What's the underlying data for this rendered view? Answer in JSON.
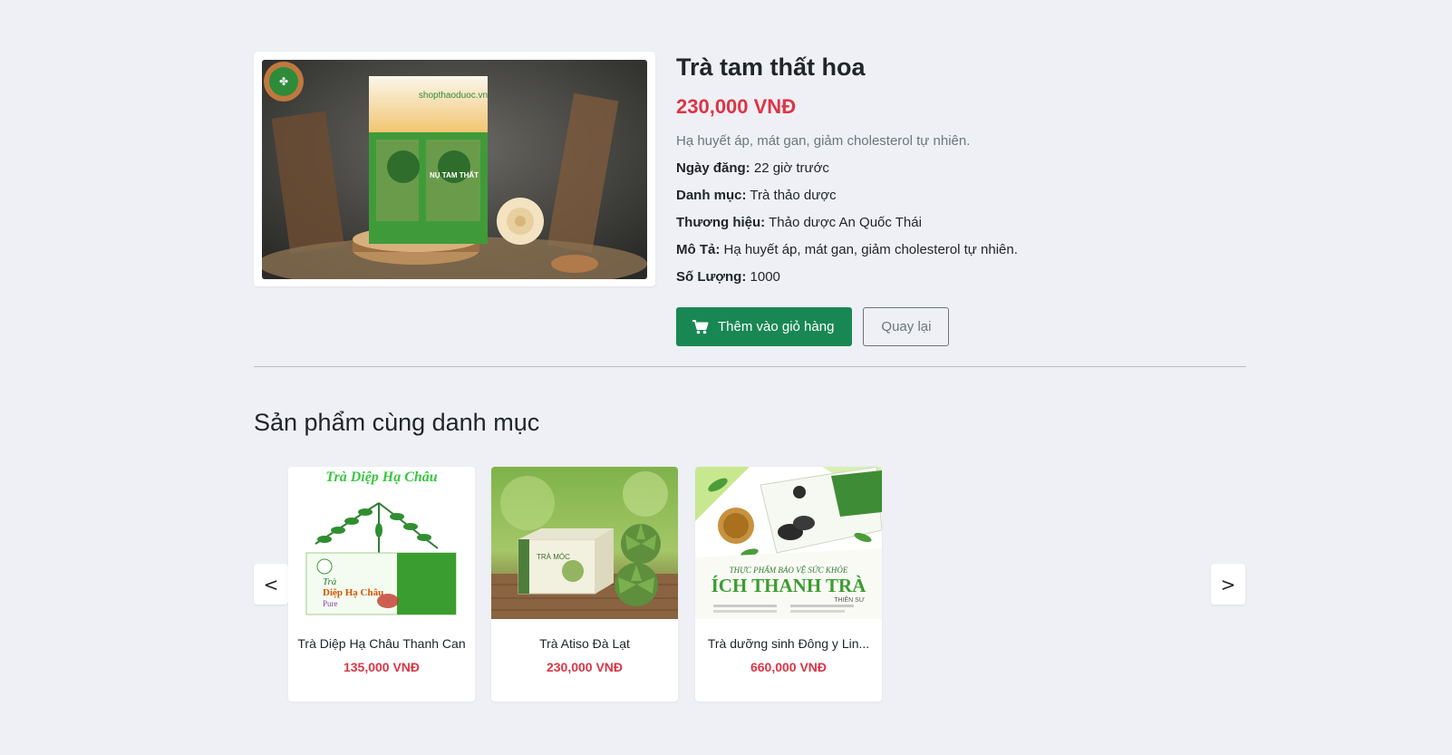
{
  "product": {
    "title": "Trà tam thất hoa",
    "price": "230,000 VNĐ",
    "short_desc": "Hạ huyết áp, mát gan, giảm cholesterol tự nhiên.",
    "image_brand_text": "shopthaoduoc.vn",
    "image_pack_text": "NỤ TAM THẤT",
    "meta": {
      "date_label": "Ngày đăng:",
      "date_value": "22 giờ trước",
      "category_label": "Danh mục:",
      "category_value": "Trà thảo dược",
      "brand_label": "Thương hiệu:",
      "brand_value": "Thảo dược An Quốc Thái",
      "desc_label": "Mô Tả:",
      "desc_value": "Hạ huyết áp, mát gan, giảm cholesterol tự nhiên.",
      "qty_label": "Số Lượng:",
      "qty_value": "1000"
    },
    "add_to_cart_label": "Thêm vào giỏ hàng",
    "back_label": "Quay lại"
  },
  "related": {
    "section_title": "Sản phẩm cùng danh mục",
    "prev_label": "<",
    "next_label": ">",
    "items": [
      {
        "name": "Trà Diệp Hạ Châu Thanh Can",
        "price": "135,000 VNĐ",
        "img_title": "Trà Diệp Hạ Châu",
        "img_sub": "Trà",
        "img_sub2": "Diệp Hạ Châu",
        "img_sub3": "Pure"
      },
      {
        "name": "Trà Atiso Đà Lạt",
        "price": "230,000 VNĐ",
        "img_box": "TRÀ MÓC"
      },
      {
        "name": "Trà dưỡng sinh Đông y Lin...",
        "price": "660,000 VNĐ",
        "img_top": "THỰC PHẨM BẢO VỆ SỨC KHỎE",
        "img_title": "ÍCH THANH TRÀ",
        "img_sub": "THIÊN SƯ"
      }
    ]
  },
  "colors": {
    "accent": "#198754",
    "price": "#dc3545",
    "background": "#eef0f5"
  },
  "icons": {
    "cart": "cart-icon"
  }
}
